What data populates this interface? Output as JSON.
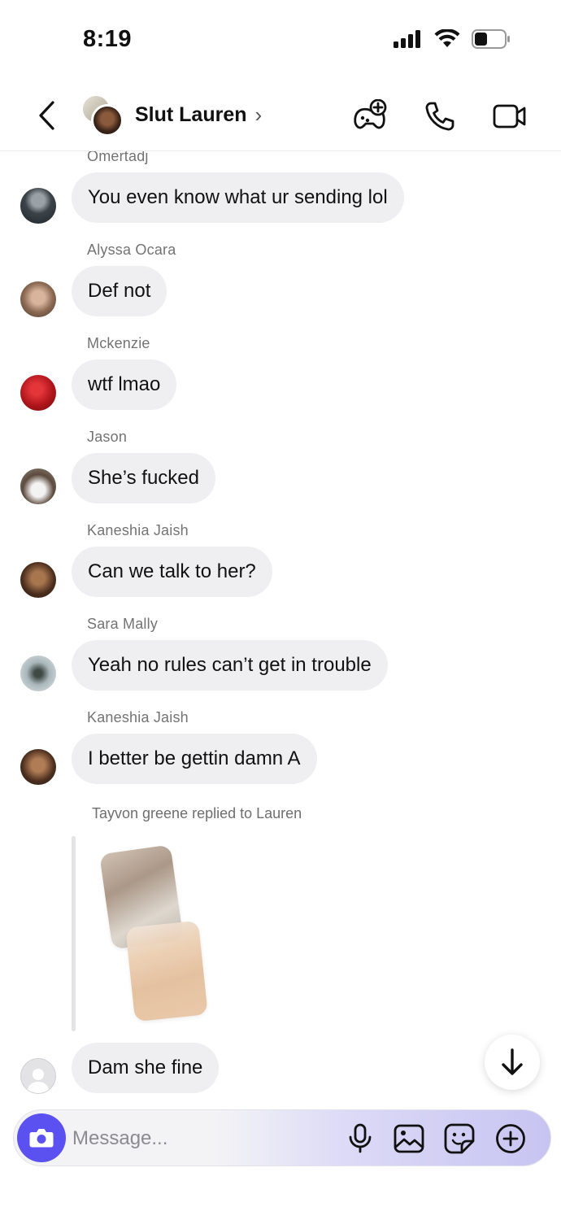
{
  "status_bar": {
    "time": "8:19"
  },
  "header": {
    "chat_name": "Slut Lauren",
    "chevron": "›"
  },
  "messages": [
    {
      "sender": "Omertadj",
      "text": "You even know what ur sending lol"
    },
    {
      "sender": "Alyssa Ocara",
      "text": "Def not"
    },
    {
      "sender": "Mckenzie",
      "text": "wtf lmao"
    },
    {
      "sender": "Jason",
      "text": "She’s fucked"
    },
    {
      "sender": "Kaneshia Jaish",
      "text": "Can we talk to her?"
    },
    {
      "sender": "Sara Mally",
      "text": "Yeah no rules can’t get in trouble"
    },
    {
      "sender": "Kaneshia Jaish",
      "text": "I better be gettin damn A"
    }
  ],
  "reply": {
    "note": "Tayvon greene replied to Lauren",
    "text": "Dam she fine"
  },
  "composer": {
    "placeholder": "Message..."
  },
  "colors": {
    "accent": "#5b51f1",
    "bubble": "#efeff1",
    "meta_text": "#737373"
  },
  "icons": [
    "back-arrow-icon",
    "games-icon",
    "phone-icon",
    "video-camera-icon",
    "arrow-down-icon",
    "camera-icon",
    "microphone-icon",
    "gallery-icon",
    "sticker-icon",
    "plus-icon",
    "signal-icon",
    "wifi-icon",
    "battery-icon"
  ]
}
